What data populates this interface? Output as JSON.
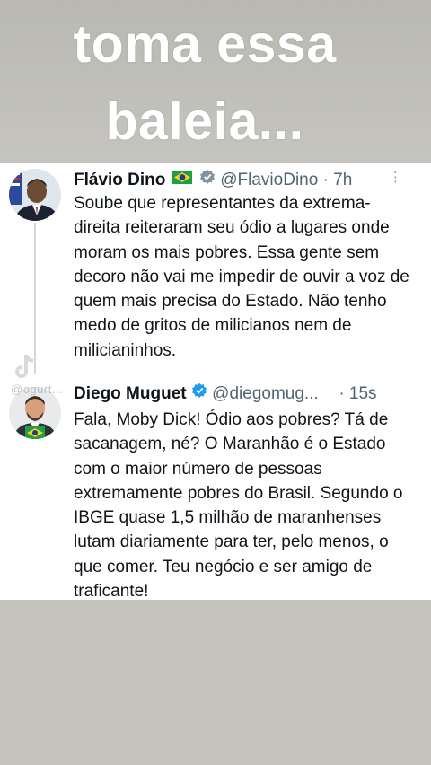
{
  "caption": {
    "line1": "toma essa",
    "line2": "baleia..."
  },
  "tweets": [
    {
      "display_name": "Flávio Dino",
      "handle": "@FlavioDino",
      "time": "· 7h",
      "text": "Soube que representantes da extrema-direita reiteraram seu ódio a lugares onde moram os mais pobres. Essa gente sem decoro não vai me impedir de ouvir a voz de quem mais precisa do Estado. Não tenho medo de gritos de milicianos nem de milicianinhos."
    },
    {
      "display_name": "Diego Muguet",
      "handle": "@diegomug...",
      "time": "· 15s",
      "text": "Fala, Moby Dick! Ódio aos pobres? Tá de sacanagem, né? O Maranhão é o Estado com o maior número de pessoas extremamente pobres do Brasil. Segundo o IBGE quase 1,5 milhão de maranhenses lutam diariamente para ter, pelo menos, o que comer. Teu negócio e ser amigo de traficante!"
    }
  ],
  "watermark": {
    "handle": "@ogurt..."
  },
  "colors": {
    "verified": "#1d9bf0",
    "text": "#0f1419",
    "secondary": "#536471"
  }
}
